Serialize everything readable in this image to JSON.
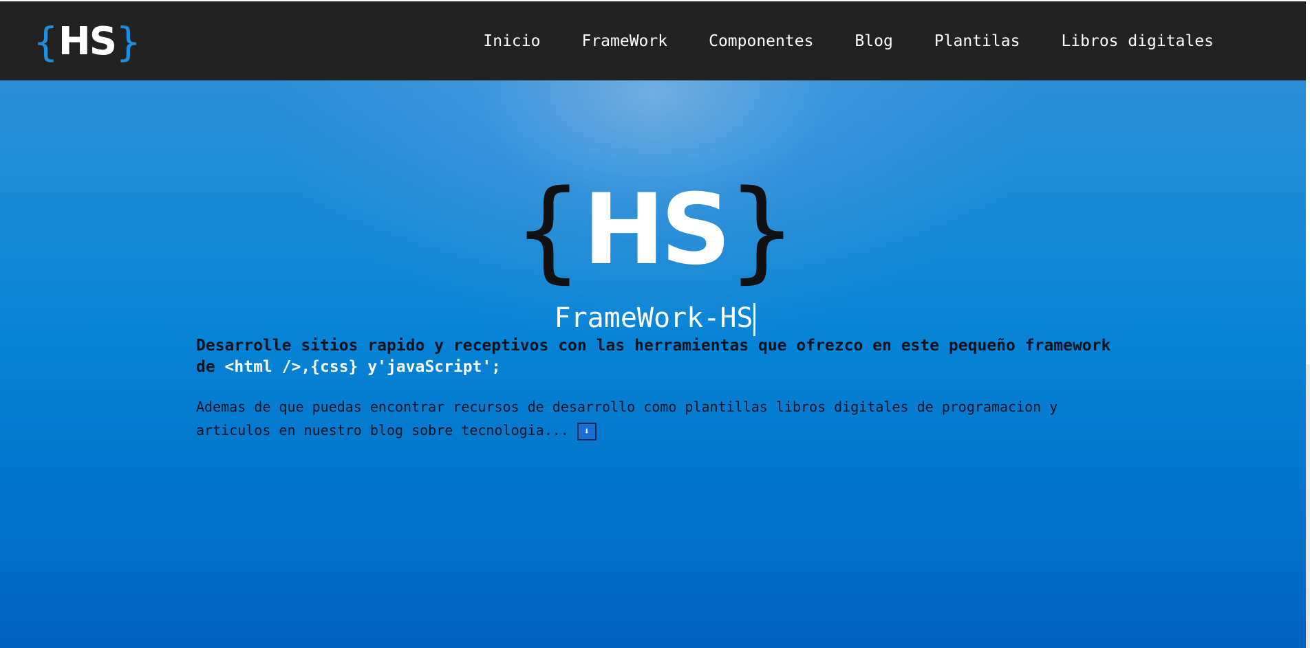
{
  "nav": {
    "logo": {
      "open": "{",
      "letters": "HS",
      "close": "}"
    },
    "links": [
      "Inicio",
      "FrameWork",
      "Componentes",
      "Blog",
      "Plantilas",
      "Libros digitales"
    ]
  },
  "hero": {
    "logo": {
      "open": "{",
      "letters": "HS",
      "close": "}"
    },
    "title": "FrameWork-HS",
    "tagline": {
      "text_before": "Desarrolle sitios rapido y receptivos con las herramientas que ofrezco en este pequeño framework de ",
      "code": "<html />,{css} y'javaScript';"
    },
    "description": "Ademas de que puedas encontrar recursos de desarrollo como plantillas libros digitales de programacion y articulos en nuestro blog sobre tecnologia... ",
    "more_button_glyph": "⬇"
  },
  "colors": {
    "navbar": "#222222",
    "brand_blue": "#1e8fe0",
    "hero_blue": "#0784d6"
  }
}
